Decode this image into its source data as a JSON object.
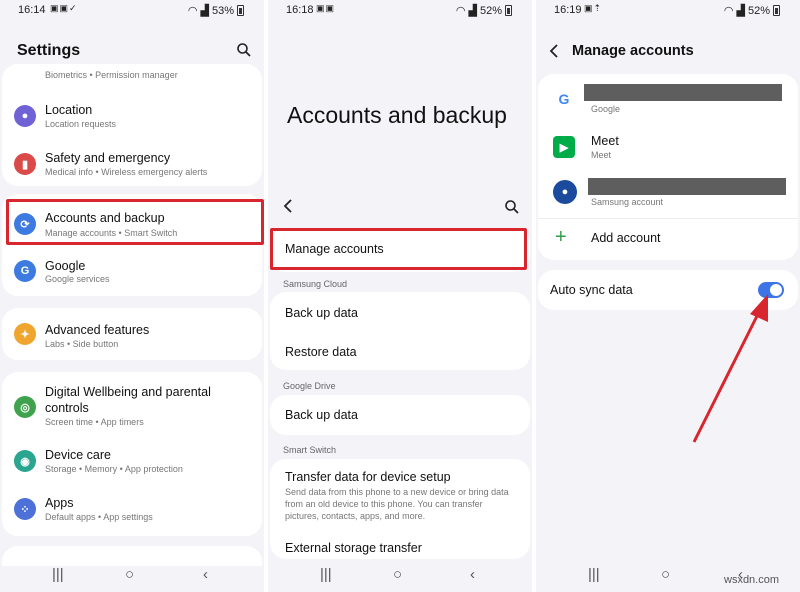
{
  "panel1": {
    "status": {
      "time": "16:14",
      "battery": "53%"
    },
    "title": "Settings",
    "top_partial": "Biometrics • Permission manager",
    "items": [
      {
        "title": "Location",
        "subtitle": "Location requests",
        "icon": "location-icon",
        "color": "#6f62d6"
      },
      {
        "title": "Safety and emergency",
        "subtitle": "Medical info • Wireless emergency alerts",
        "icon": "safety-icon",
        "color": "#d94a48"
      },
      {
        "title": "Accounts and backup",
        "subtitle": "Manage accounts • Smart Switch",
        "icon": "sync-icon",
        "color": "#3d7be0"
      },
      {
        "title": "Google",
        "subtitle": "Google services",
        "icon": "google-icon",
        "color": "#3d7be0"
      },
      {
        "title": "Advanced features",
        "subtitle": "Labs • Side button",
        "icon": "gear-plus-icon",
        "color": "#f0a52e"
      },
      {
        "title": "Digital Wellbeing and parental controls",
        "subtitle": "Screen time • App timers",
        "icon": "wellbeing-icon",
        "color": "#3fa34d"
      },
      {
        "title": "Device care",
        "subtitle": "Storage • Memory • App protection",
        "icon": "device-care-icon",
        "color": "#2aa58f"
      },
      {
        "title": "Apps",
        "subtitle": "Default apps • App settings",
        "icon": "apps-icon",
        "color": "#4d71d9"
      }
    ]
  },
  "panel2": {
    "status": {
      "time": "16:18",
      "battery": "52%"
    },
    "header": "Accounts and backup",
    "manage": "Manage accounts",
    "samsung_cloud": "Samsung Cloud",
    "backup": "Back up data",
    "restore": "Restore data",
    "google_drive": "Google Drive",
    "gbackup": "Back up data",
    "smart_switch": "Smart Switch",
    "transfer_title": "Transfer data for device setup",
    "transfer_desc": "Send data from this phone to a new device or bring data from an old device to this phone. You can transfer pictures, contacts, apps, and more.",
    "external": "External storage transfer"
  },
  "panel3": {
    "status": {
      "time": "16:19",
      "battery": "52%"
    },
    "title": "Manage accounts",
    "google_label": "Google",
    "meet_title": "Meet",
    "meet_sub": "Meet",
    "samsung_label": "Samsung account",
    "add_account": "Add account",
    "auto_sync": "Auto sync data",
    "auto_sync_on": true
  },
  "watermark": "wsxdn.com",
  "colors": {
    "highlight": "#d7262e",
    "toggle": "#3e74e6"
  }
}
